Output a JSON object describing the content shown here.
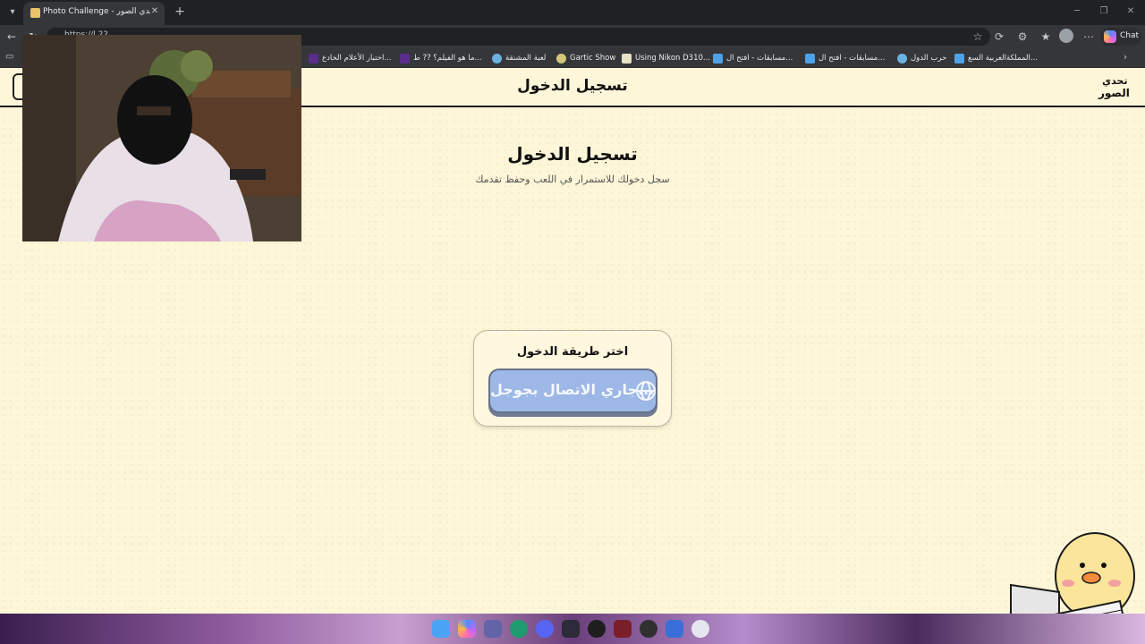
{
  "browser": {
    "tab": {
      "title": "Photo Challenge - لعبة تحدي الصور"
    },
    "address": {
      "url": "https://l.22..."
    },
    "chat_label": "Chat",
    "bookmarks": [
      {
        "label": "المملكةالعربية السع..."
      },
      {
        "label": "حرب الدول"
      },
      {
        "label": "مسابقات - افتح ال..."
      },
      {
        "label": "مسابقات - افتح ال..."
      },
      {
        "label": "Using Nikon D310..."
      },
      {
        "label": "Gartic Show"
      },
      {
        "label": "لعبة المشنقة"
      },
      {
        "label": "ما هو الفيلم؟ ?? ط..."
      },
      {
        "label": "اختبار الأعلام الخادع..."
      }
    ]
  },
  "page": {
    "header_title": "تسجيل الدخول",
    "logo_top": "تحدي",
    "logo_bottom": "الصور",
    "main_title": "تسجيل الدخول",
    "subtitle": "سجل دخولك للاستمرار في اللعب وحفظ تقدمك",
    "card_title": "اختر طريقة الدخول",
    "google_button": "جاري الاتصال بجوجل..."
  },
  "taskbar": {
    "apps": [
      "start-icon",
      "copilot-icon",
      "teams-icon",
      "edge-icon",
      "discord-icon",
      "nzxt-icon",
      "obs-icon",
      "video-editor-icon",
      "clock-icon",
      "photos-icon",
      "vpn-icon"
    ]
  }
}
